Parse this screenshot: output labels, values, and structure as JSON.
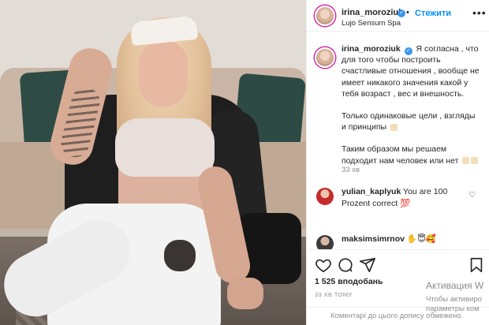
{
  "header": {
    "username": "irina_moroziuk",
    "dot": "•",
    "follow_label": "Стежити",
    "location": "Lujo Sensum Spa",
    "more_icon": "more-horizontal-icon"
  },
  "caption": {
    "username": "irina_moroziuk",
    "paragraph1": "Я согласна , что для того чтобы построить счастливые отношения , вообще не имеет никакого значения какой у тебя возраст , вес и внешность.",
    "paragraph2": "Только одинаковые цели , взгляды и принципы",
    "paragraph3": "Таким образом мы решаем подходит нам человек или нет",
    "time": "33 хв"
  },
  "comments": [
    {
      "username": "yulian_kaplyuk",
      "text": "You are 100 Prozent correct 💯"
    },
    {
      "username": "maksimsimrnov",
      "text": "✋😇🥰"
    }
  ],
  "actions": {
    "likes": "1 525 вподобань",
    "ago": "33 ХВ ТОМУ",
    "add_comment_placeholder": "Коментарі до цього допису обмежено."
  },
  "watermark": {
    "title": "Активация W",
    "subtitle": "Чтобы активиро параметры ком"
  },
  "colors": {
    "accent": "#0095f6",
    "verified": "#3897f0",
    "muted": "#8e8e8e",
    "border": "#efefef"
  }
}
